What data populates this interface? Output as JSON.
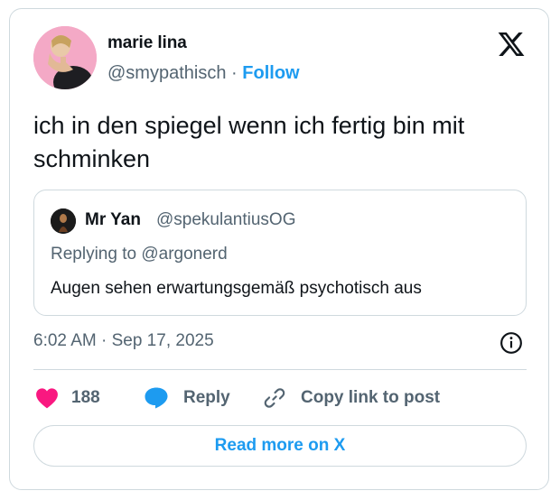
{
  "author": {
    "name": "marie lina",
    "handle": "@smypathisch",
    "separator": "·",
    "follow_label": "Follow"
  },
  "tweet": {
    "text": "ich in den spiegel wenn ich fertig bin mit schminken",
    "timestamp": "6:02 AM · Sep 17, 2025"
  },
  "quoted": {
    "name": "Mr Yan",
    "handle": "@spekulantiusOG",
    "replying_to": "Replying to @argonerd",
    "text": "Augen sehen erwartungsgemäß psychotisch aus"
  },
  "actions": {
    "like_count": "188",
    "reply_label": "Reply",
    "copy_label": "Copy link to post"
  },
  "read_more_label": "Read more on X",
  "colors": {
    "accent": "#1d9bf0",
    "like": "#f91880",
    "secondary_text": "#536471",
    "border": "#cfd9de"
  },
  "icons": [
    "x-logo-icon",
    "info-icon",
    "heart-icon",
    "reply-bubble-icon",
    "link-icon"
  ]
}
